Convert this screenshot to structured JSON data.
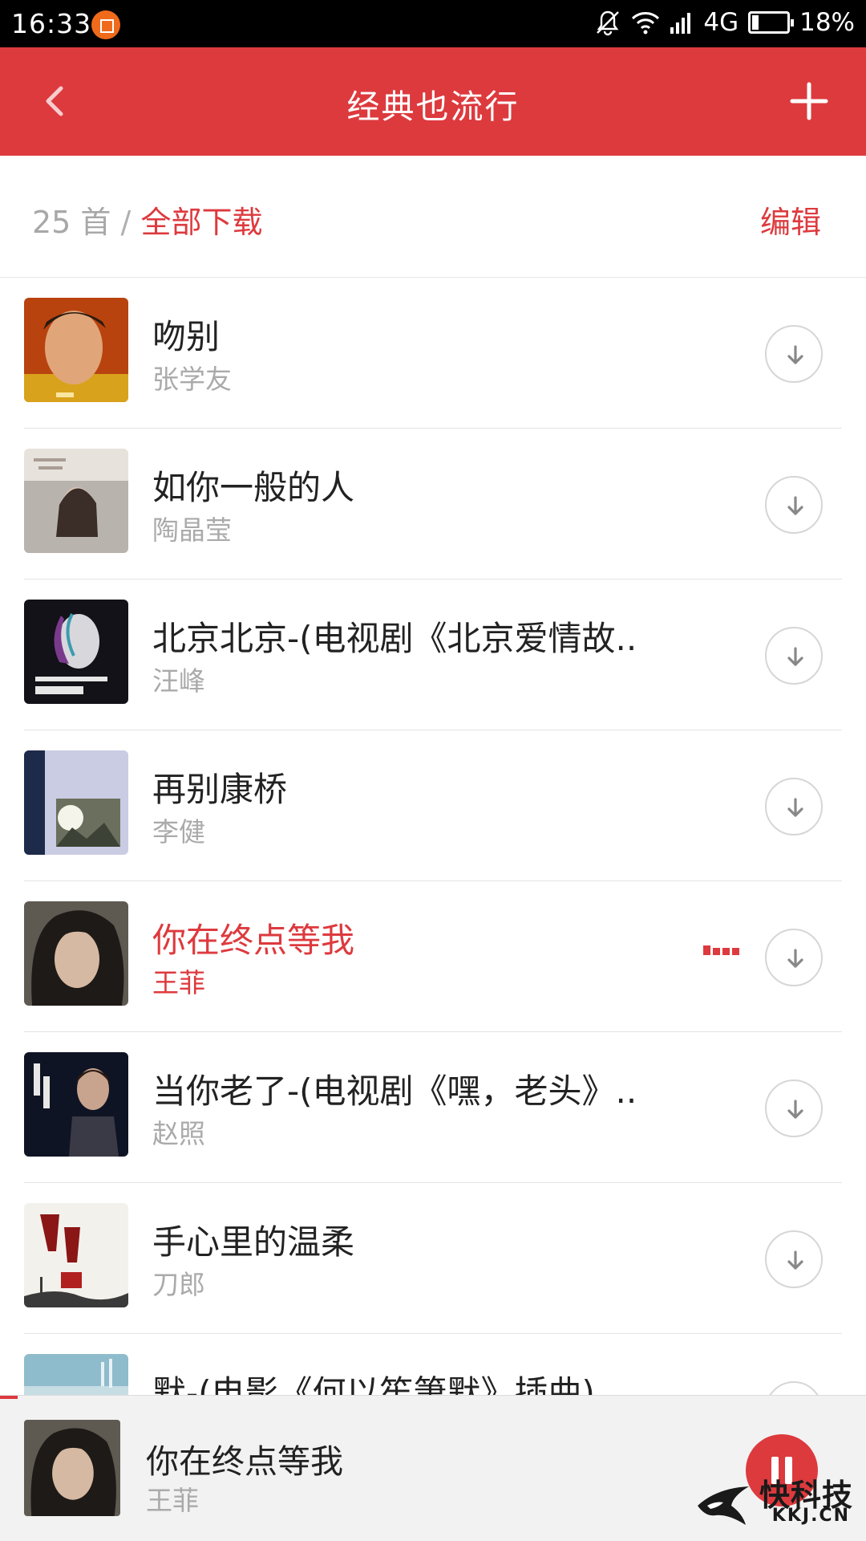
{
  "status_bar": {
    "time": "16:33",
    "network": "4G",
    "battery": "18%",
    "battery_level": 0.18,
    "icons": [
      "app-notification-icon",
      "bell-muted-icon",
      "wifi-icon",
      "signal-icon",
      "battery-icon"
    ]
  },
  "header": {
    "title": "经典也流行",
    "back_icon": "chevron-left-icon",
    "add_icon": "plus-icon"
  },
  "summary": {
    "count": "25 首",
    "separator": "/",
    "download_all": "全部下载",
    "edit": "编辑"
  },
  "songs": [
    {
      "title": "吻别",
      "artist": "张学友",
      "playing": false
    },
    {
      "title": "如你一般的人",
      "artist": "陶晶莹",
      "playing": false
    },
    {
      "title": "北京北京-(电视剧《北京爱情故..",
      "artist": "汪峰",
      "playing": false
    },
    {
      "title": "再别康桥",
      "artist": "李健",
      "playing": false
    },
    {
      "title": "你在终点等我",
      "artist": "王菲",
      "playing": true
    },
    {
      "title": "当你老了-(电视剧《嘿，老头》..",
      "artist": "赵照",
      "playing": false
    },
    {
      "title": "手心里的温柔",
      "artist": "刀郎",
      "playing": false
    },
    {
      "title": "默-(电影《何以笙箫默》插曲)",
      "artist": "",
      "playing": false
    }
  ],
  "now_playing": {
    "title": "你在终点等我",
    "artist": "王菲",
    "control": "pause-icon"
  },
  "watermark": {
    "name": "快科技",
    "domain": "KKJ.CN"
  },
  "colors": {
    "accent": "#dd3a3e",
    "status_bar": "#000000",
    "muted_text": "#aaaaaa"
  }
}
